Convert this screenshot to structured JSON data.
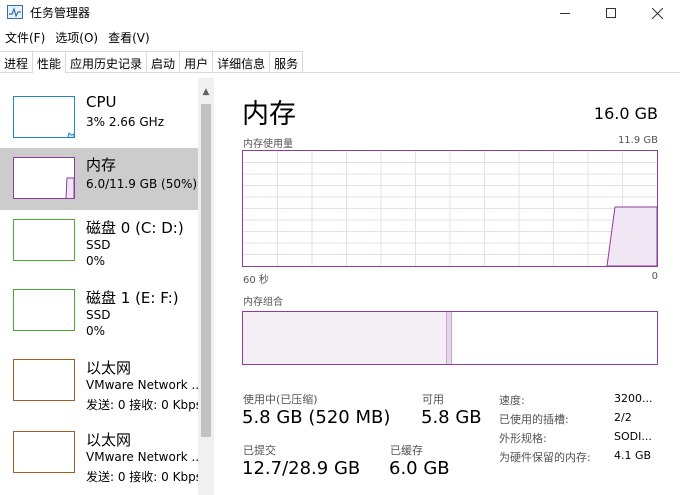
{
  "window": {
    "title": "任务管理器"
  },
  "menu": [
    "文件(F)",
    "选项(O)",
    "查看(V)"
  ],
  "tabs": [
    "进程",
    "性能",
    "应用历史记录",
    "启动",
    "用户",
    "详细信息",
    "服务"
  ],
  "active_tab": "性能",
  "sidebar": {
    "items": [
      {
        "title": "CPU",
        "line1": "3% 2.66 GHz",
        "line2": "",
        "color": "#1e88c8",
        "selected": false,
        "usage_fraction": 0.03
      },
      {
        "title": "内存",
        "line1": "6.0/11.9 GB (50%)",
        "line2": "",
        "color": "#8b3d9a",
        "selected": true,
        "usage_fraction": 0.5
      },
      {
        "title": "磁盘 0 (C: D:)",
        "line1": "SSD",
        "line2": "0%",
        "color": "#4da831",
        "selected": false,
        "usage_fraction": 0
      },
      {
        "title": "磁盘 1 (E: F:)",
        "line1": "SSD",
        "line2": "0%",
        "color": "#4da831",
        "selected": false,
        "usage_fraction": 0
      },
      {
        "title": "以太网",
        "line1": "VMware Network ...",
        "line2": "发送: 0 接收: 0 Kbps",
        "color": "#a35a1c",
        "selected": false,
        "usage_fraction": 0
      },
      {
        "title": "以太网",
        "line1": "VMware Network ...",
        "line2": "发送: 0 接收: 0 Kbps",
        "color": "#a35a1c",
        "selected": false,
        "usage_fraction": 0
      }
    ]
  },
  "memory": {
    "heading": "内存",
    "total": "16.0 GB",
    "usage_graph_label": "内存使用量",
    "usage_graph_max": "11.9 GB",
    "time_left": "60 秒",
    "time_right": "0",
    "composition_label": "内存组合",
    "composition": {
      "in_use_fraction": 0.49,
      "modified_fraction": 0.015
    },
    "accent_color": "#8b3d9a",
    "in_use_label": "使用中(已压缩)",
    "in_use_value": "5.8 GB (520 MB)",
    "available_label": "可用",
    "available_value": "5.8 GB",
    "committed_label": "已提交",
    "committed_value": "12.7/28.9 GB",
    "cached_label": "已缓存",
    "cached_value": "6.0 GB",
    "details": [
      {
        "key": "速度:",
        "value": "3200..."
      },
      {
        "key": "已使用的插槽:",
        "value": "2/2"
      },
      {
        "key": "外形规格:",
        "value": "SODI..."
      },
      {
        "key": "为硬件保留的内存:",
        "value": "4.1 GB"
      }
    ]
  }
}
